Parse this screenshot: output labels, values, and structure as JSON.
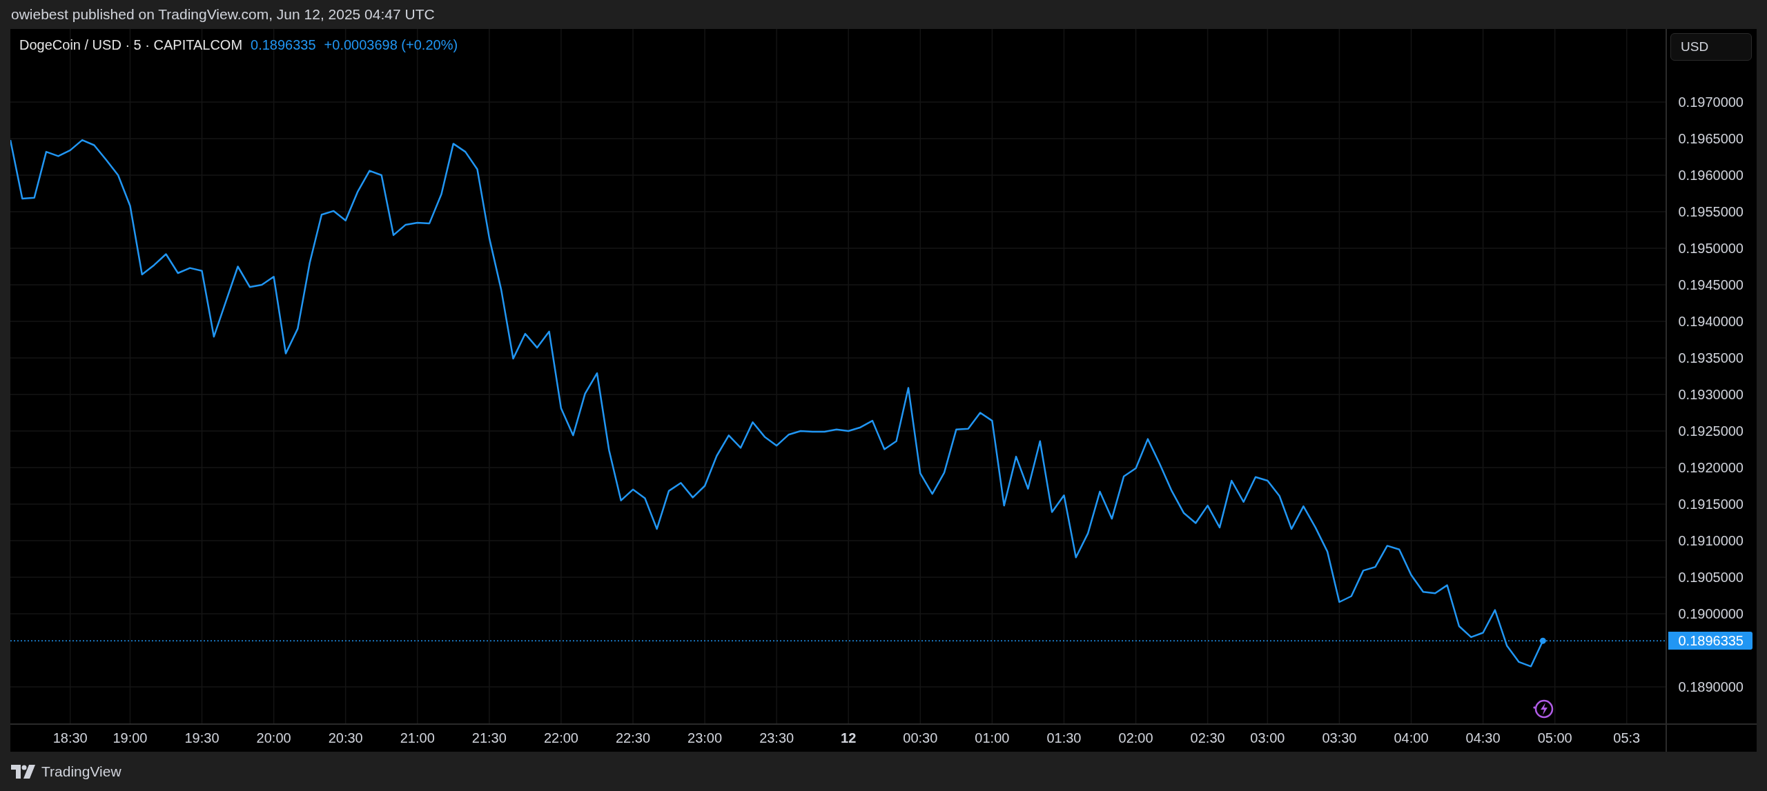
{
  "header": {
    "byline": "owiebest published on TradingView.com, Jun 12, 2025 04:47 UTC"
  },
  "chart": {
    "legend": {
      "symbol": "DogeCoin / USD · 5 · CAPITALCOM",
      "price": "0.1896335",
      "change": "+0.0003698 (+0.20%)"
    },
    "currency_button": "USD",
    "last_price_label": "0.1896335",
    "chart_data": {
      "type": "line",
      "categories": [
        null,
        null,
        null,
        null,
        null,
        "18:30",
        null,
        null,
        null,
        null,
        "19:00",
        null,
        null,
        null,
        null,
        null,
        "19:30",
        null,
        null,
        null,
        null,
        null,
        "20:00",
        null,
        null,
        null,
        null,
        null,
        "20:30",
        null,
        null,
        null,
        null,
        null,
        "21:00",
        null,
        null,
        null,
        null,
        null,
        "21:30",
        null,
        null,
        null,
        null,
        null,
        "22:00",
        null,
        null,
        null,
        null,
        null,
        "22:30",
        null,
        null,
        null,
        null,
        null,
        "23:00",
        null,
        null,
        null,
        null,
        null,
        "23:30",
        null,
        null,
        null,
        null,
        null,
        "12",
        null,
        null,
        null,
        null,
        null,
        "00:30",
        null,
        null,
        null,
        null,
        null,
        "01:00",
        null,
        null,
        null,
        null,
        null,
        "01:30",
        null,
        null,
        null,
        null,
        null,
        "02:00",
        null,
        null,
        null,
        null,
        null,
        "02:30",
        null,
        null,
        null,
        null,
        "03:00",
        null,
        null,
        null,
        null,
        null,
        "03:30",
        null,
        null,
        null,
        null,
        null,
        "04:00",
        null,
        null,
        null,
        null,
        null,
        "04:30",
        null,
        null,
        null,
        null,
        null,
        "05:00",
        null,
        null,
        null,
        null,
        null,
        "05:3"
      ],
      "series": [
        {
          "color": "#2196f3",
          "values": [
            0.19648,
            0.19568,
            0.19569,
            0.19632,
            0.19626,
            0.19634,
            0.19648,
            0.19641,
            0.19621,
            0.196,
            0.19558,
            0.19464,
            0.19477,
            0.19492,
            0.19466,
            0.19473,
            0.19469,
            0.19379,
            0.19427,
            0.19475,
            0.19447,
            0.1945,
            0.19461,
            0.19356,
            0.1939,
            0.1948,
            0.19546,
            0.19551,
            0.19538,
            0.19577,
            0.19606,
            0.196,
            0.19518,
            0.19532,
            0.19535,
            0.19534,
            0.19574,
            0.19643,
            0.19632,
            0.19608,
            0.19514,
            0.19443,
            0.19349,
            0.19383,
            0.19364,
            0.19386,
            0.19281,
            0.19244,
            0.19301,
            0.19329,
            0.19224,
            0.19155,
            0.1917,
            0.19158,
            0.19116,
            0.19168,
            0.19179,
            0.19159,
            0.19175,
            0.19216,
            0.19244,
            0.19227,
            0.19262,
            0.19242,
            0.1923,
            0.19245,
            0.1925,
            0.19249,
            0.19249,
            0.19252,
            0.1925,
            0.19255,
            0.19264,
            0.19225,
            0.19236,
            0.19309,
            0.19192,
            0.19164,
            0.19193,
            0.19252,
            0.19253,
            0.19275,
            0.19264,
            0.19148,
            0.19215,
            0.19171,
            0.19236,
            0.19139,
            0.19162,
            0.19077,
            0.1911,
            0.19167,
            0.1913,
            0.19188,
            0.19199,
            0.19239,
            0.19205,
            0.19168,
            0.19138,
            0.19124,
            0.19148,
            0.19118,
            0.19182,
            0.19153,
            0.19187,
            0.19182,
            0.19161,
            0.19116,
            0.19147,
            0.19118,
            0.19085,
            0.19016,
            0.19024,
            0.19059,
            0.19064,
            0.19093,
            0.19088,
            0.19053,
            0.1903,
            0.19028,
            0.19039,
            0.18983,
            0.18968,
            0.18974,
            0.19005,
            0.18956,
            0.18934,
            0.18928,
            0.18963,
            null,
            null,
            null,
            null,
            null,
            null,
            null
          ]
        }
      ],
      "grid": true,
      "ref_lines": [
        {
          "axis": "y",
          "value": 0.18963,
          "color": "#2196f3"
        }
      ],
      "ylim": [
        0.18849,
        0.198
      ],
      "yticks": [
        {
          "value": 0.197,
          "label": "0.1970000"
        },
        {
          "value": 0.1965,
          "label": "0.1965000"
        },
        {
          "value": 0.196,
          "label": "0.1960000"
        },
        {
          "value": 0.1955,
          "label": "0.1955000"
        },
        {
          "value": 0.195,
          "label": "0.1950000"
        },
        {
          "value": 0.1945,
          "label": "0.1945000"
        },
        {
          "value": 0.194,
          "label": "0.1940000"
        },
        {
          "value": 0.1935,
          "label": "0.1935000"
        },
        {
          "value": 0.193,
          "label": "0.1930000"
        },
        {
          "value": 0.1925,
          "label": "0.1925000"
        },
        {
          "value": 0.192,
          "label": "0.1920000"
        },
        {
          "value": 0.1915,
          "label": "0.1915000"
        },
        {
          "value": 0.191,
          "label": "0.1910000"
        },
        {
          "value": 0.1905,
          "label": "0.1905000"
        },
        {
          "value": 0.19,
          "label": "0.1900000"
        },
        {
          "value": 0.189,
          "label": "0.1890000"
        }
      ]
    }
  },
  "footer": {
    "brand": "TradingView"
  }
}
